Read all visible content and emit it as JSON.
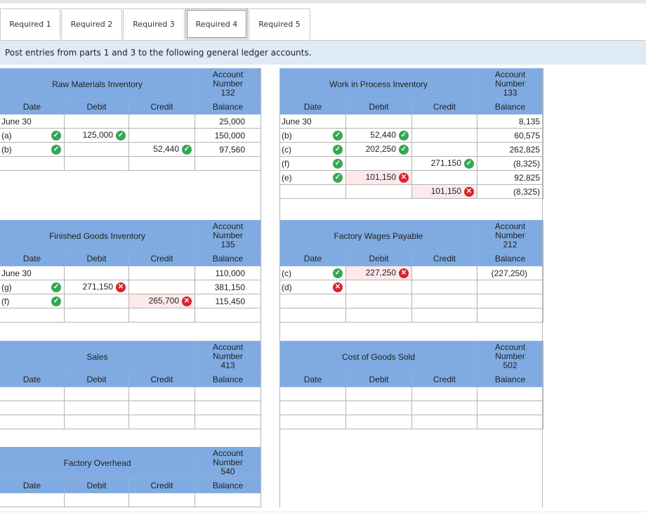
{
  "tabs": [
    "Required 1",
    "Required 2",
    "Required 3",
    "Required 4",
    "Required 5"
  ],
  "instruction": "Post entries from parts 1 and 3 to the following general ledger accounts.",
  "labels": {
    "account": "Account",
    "number": "Number",
    "date": "Date",
    "debit": "Debit",
    "credit": "Credit",
    "balance": "Balance"
  },
  "raw": {
    "name": "Raw Materials Inventory",
    "number": "132",
    "rows": [
      {
        "date": "June 30",
        "debit": "",
        "credit": "",
        "balance": "25,000"
      },
      {
        "date": "(a)",
        "debit": "125,000",
        "credit": "",
        "balance": "150,000"
      },
      {
        "date": "(b)",
        "debit": "",
        "credit": "52,440",
        "balance": "97,560"
      }
    ]
  },
  "wip": {
    "name": "Work in Process Inventory",
    "number": "133",
    "rows": [
      {
        "date": "June 30",
        "debit": "",
        "credit": "",
        "balance": "8,135"
      },
      {
        "date": "(b)",
        "debit": "52,440",
        "credit": "",
        "balance": "60,575"
      },
      {
        "date": "(c)",
        "debit": "202,250",
        "credit": "",
        "balance": "262,825"
      },
      {
        "date": "(f)",
        "debit": "",
        "credit": "271,150",
        "balance": "(8,325)"
      },
      {
        "date": "(e)",
        "debit": "101,150",
        "credit": "",
        "balance": "92,825"
      },
      {
        "date": "",
        "debit": "",
        "credit": "101,150",
        "balance": "(8,325)"
      }
    ]
  },
  "fg": {
    "name": "Finished Goods Inventory",
    "number": "135",
    "rows": [
      {
        "date": "June 30",
        "debit": "",
        "credit": "",
        "balance": "110,000"
      },
      {
        "date": "(g)",
        "debit": "271,150",
        "credit": "",
        "balance": "381,150"
      },
      {
        "date": "(f)",
        "debit": "",
        "credit": "265,700",
        "balance": "115,450"
      }
    ]
  },
  "fwp": {
    "name": "Factory Wages Payable",
    "number": "212",
    "rows": [
      {
        "date": "(c)",
        "debit": "227,250",
        "credit": "",
        "balance": "(227,250)"
      },
      {
        "date": "(d)",
        "debit": "",
        "credit": "",
        "balance": ""
      }
    ]
  },
  "sales": {
    "name": "Sales",
    "number": "413"
  },
  "cogs": {
    "name": "Cost of Goods Sold",
    "number": "502"
  },
  "fo": {
    "name": "Factory Overhead",
    "number": "540"
  },
  "colors": {
    "header": "#7fabe2",
    "instruction": "#dfeaf7",
    "correct": "#35a853",
    "incorrect": "#d8232a",
    "incorrect_cell": "#fde9ea"
  }
}
